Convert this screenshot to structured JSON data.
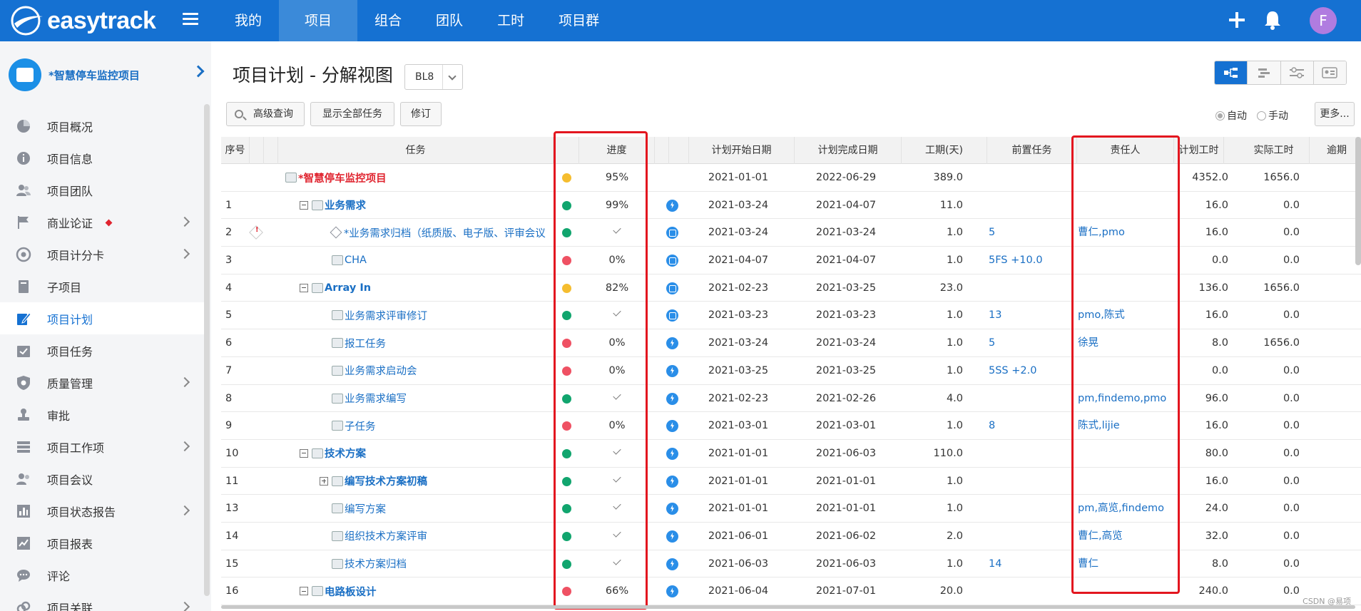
{
  "app": {
    "logo_text": "easytrack"
  },
  "topnav": {
    "items": [
      {
        "label": "我的",
        "active": false
      },
      {
        "label": "项目",
        "active": true
      },
      {
        "label": "组合",
        "active": false
      },
      {
        "label": "团队",
        "active": false
      },
      {
        "label": "工时",
        "active": false
      },
      {
        "label": "项目群",
        "active": false
      }
    ],
    "avatar_letter": "F",
    "accent_color": "#1571d2"
  },
  "sidebar": {
    "project_name": "*智慧停车监控项目",
    "items": [
      {
        "label": "项目概况",
        "icon": "pie-chart-icon",
        "has_arrow": false
      },
      {
        "label": "项目信息",
        "icon": "info-icon",
        "has_arrow": false
      },
      {
        "label": "项目团队",
        "icon": "team-icon",
        "has_arrow": false
      },
      {
        "label": "商业论证",
        "icon": "flag-icon",
        "has_arrow": true,
        "badge": true
      },
      {
        "label": "项目计分卡",
        "icon": "target-icon",
        "has_arrow": true
      },
      {
        "label": "子项目",
        "icon": "book-icon",
        "has_arrow": false
      },
      {
        "label": "项目计划",
        "icon": "edit-plan-icon",
        "has_arrow": false,
        "active": true
      },
      {
        "label": "项目任务",
        "icon": "task-calendar-icon",
        "has_arrow": false
      },
      {
        "label": "质量管理",
        "icon": "shield-icon",
        "has_arrow": true
      },
      {
        "label": "审批",
        "icon": "stamp-icon",
        "has_arrow": false
      },
      {
        "label": "项目工作项",
        "icon": "list-icon",
        "has_arrow": true
      },
      {
        "label": "项目会议",
        "icon": "meeting-icon",
        "has_arrow": false
      },
      {
        "label": "项目状态报告",
        "icon": "bar-chart-icon",
        "has_arrow": true
      },
      {
        "label": "项目报表",
        "icon": "report-icon",
        "has_arrow": false
      },
      {
        "label": "评论",
        "icon": "comment-icon",
        "has_arrow": false
      },
      {
        "label": "项目关联",
        "icon": "link-icon",
        "has_arrow": true
      }
    ]
  },
  "main": {
    "title": "项目计划 - 分解视图",
    "baseline": "BL8",
    "buttons": {
      "advanced_search": "高级查询",
      "show_all": "显示全部任务",
      "revise": "修订",
      "more": "更多..."
    },
    "radio": {
      "auto": "自动",
      "manual": "手动"
    }
  },
  "grid": {
    "headers": {
      "seq": "序号",
      "task": "任务",
      "progress": "进度",
      "start": "计划开始日期",
      "end": "计划完成日期",
      "duration": "工期(天)",
      "pred": "前置任务",
      "owner": "责任人",
      "plan_hours": "计划工时",
      "actual_hours": "实际工时",
      "overdue": "逾期"
    },
    "status_colors": {
      "yellow": "#f5bd2f",
      "green": "#11a56e",
      "red": "#ef5163"
    },
    "rows": [
      {
        "seq": "",
        "name": "*智慧停车监控项目",
        "level": 0,
        "kind": "root",
        "status": "yellow",
        "progress": "95%",
        "type": "",
        "start": "2021-01-01",
        "end": "2022-06-29",
        "duration": "389.0",
        "pred": "",
        "owner": "",
        "plan": "4352.0",
        "actual": "1656.0"
      },
      {
        "seq": "1",
        "name": "业务需求",
        "level": 1,
        "kind": "summary",
        "expander": "minus",
        "status": "green",
        "progress": "99%",
        "type": "auto",
        "start": "2021-03-24",
        "end": "2021-04-07",
        "duration": "11.0",
        "pred": "",
        "owner": "",
        "plan": "16.0",
        "actual": "0.0"
      },
      {
        "seq": "2",
        "name": "*业务需求归档（纸质版、电子版、评审会议",
        "level": 2,
        "kind": "milestone",
        "warn": true,
        "status": "green",
        "progress": "",
        "done": true,
        "type": "manual",
        "start": "2021-03-24",
        "end": "2021-03-24",
        "duration": "1.0",
        "pred": "5",
        "owner": "曹仁,pmo",
        "plan": "16.0",
        "actual": "0.0"
      },
      {
        "seq": "3",
        "name": "CHA",
        "level": 2,
        "kind": "task",
        "status": "red",
        "progress": "0%",
        "type": "manual",
        "start": "2021-04-07",
        "end": "2021-04-07",
        "duration": "1.0",
        "pred": "5FS +10.0",
        "owner": "",
        "plan": "0.0",
        "actual": "0.0"
      },
      {
        "seq": "4",
        "name": "Array In",
        "level": 1,
        "kind": "summary",
        "expander": "minus",
        "status": "yellow",
        "progress": "82%",
        "type": "manual",
        "start": "2021-02-23",
        "end": "2021-03-25",
        "duration": "23.0",
        "pred": "",
        "owner": "",
        "plan": "136.0",
        "actual": "1656.0"
      },
      {
        "seq": "5",
        "name": "业务需求评审修订",
        "level": 2,
        "kind": "task",
        "status": "green",
        "progress": "",
        "done": true,
        "type": "manual",
        "start": "2021-03-23",
        "end": "2021-03-23",
        "duration": "1.0",
        "pred": "13",
        "owner": "pmo,陈式",
        "plan": "16.0",
        "actual": "0.0"
      },
      {
        "seq": "6",
        "name": "报工任务",
        "level": 2,
        "kind": "task",
        "status": "red",
        "progress": "0%",
        "type": "auto",
        "start": "2021-03-24",
        "end": "2021-03-24",
        "duration": "1.0",
        "pred": "5",
        "owner": "徐晃",
        "plan": "8.0",
        "actual": "1656.0"
      },
      {
        "seq": "7",
        "name": "业务需求启动会",
        "level": 2,
        "kind": "task",
        "status": "red",
        "progress": "0%",
        "type": "auto",
        "start": "2021-03-25",
        "end": "2021-03-25",
        "duration": "1.0",
        "pred": "5SS +2.0",
        "owner": "",
        "plan": "0.0",
        "actual": "0.0"
      },
      {
        "seq": "8",
        "name": "业务需求编写",
        "level": 2,
        "kind": "task",
        "status": "green",
        "progress": "",
        "done": true,
        "type": "auto",
        "start": "2021-02-23",
        "end": "2021-02-26",
        "duration": "4.0",
        "pred": "",
        "owner": "pm,findemo,pmo",
        "plan": "96.0",
        "actual": "0.0"
      },
      {
        "seq": "9",
        "name": "子任务",
        "level": 2,
        "kind": "task",
        "status": "red",
        "progress": "0%",
        "type": "auto",
        "start": "2021-03-01",
        "end": "2021-03-01",
        "duration": "1.0",
        "pred": "8",
        "owner": "陈式,lijie",
        "plan": "16.0",
        "actual": "0.0"
      },
      {
        "seq": "10",
        "name": "技术方案",
        "level": 1,
        "kind": "summary",
        "expander": "minus",
        "status": "green",
        "progress": "",
        "done": true,
        "type": "auto",
        "start": "2021-01-01",
        "end": "2021-06-03",
        "duration": "110.0",
        "pred": "",
        "owner": "",
        "plan": "80.0",
        "actual": "0.0"
      },
      {
        "seq": "11",
        "name": "编写技术方案初稿",
        "level": 2,
        "kind": "summary",
        "expander": "plus",
        "status": "green",
        "progress": "",
        "done": true,
        "type": "auto",
        "start": "2021-01-01",
        "end": "2021-01-01",
        "duration": "1.0",
        "pred": "",
        "owner": "",
        "plan": "16.0",
        "actual": "0.0"
      },
      {
        "seq": "13",
        "name": "编写方案",
        "level": 2,
        "kind": "task",
        "status": "green",
        "progress": "",
        "done": true,
        "type": "auto",
        "start": "2021-01-01",
        "end": "2021-01-01",
        "duration": "1.0",
        "pred": "",
        "owner": "pm,高览,findemo",
        "plan": "24.0",
        "actual": "0.0"
      },
      {
        "seq": "14",
        "name": "组织技术方案评审",
        "level": 2,
        "kind": "task",
        "status": "green",
        "progress": "",
        "done": true,
        "type": "auto",
        "start": "2021-06-01",
        "end": "2021-06-02",
        "duration": "2.0",
        "pred": "",
        "owner": "曹仁,高览",
        "plan": "32.0",
        "actual": "0.0"
      },
      {
        "seq": "15",
        "name": "技术方案归档",
        "level": 2,
        "kind": "task",
        "status": "green",
        "progress": "",
        "done": true,
        "type": "auto",
        "start": "2021-06-03",
        "end": "2021-06-03",
        "duration": "1.0",
        "pred": "14",
        "owner": "曹仁",
        "plan": "8.0",
        "actual": "0.0"
      },
      {
        "seq": "16",
        "name": "电路板设计",
        "level": 1,
        "kind": "summary",
        "expander": "minus",
        "status": "red",
        "progress": "66%",
        "type": "auto",
        "start": "2021-06-04",
        "end": "2021-07-01",
        "duration": "20.0",
        "pred": "",
        "owner": "",
        "plan": "240.0",
        "actual": "0.0"
      }
    ]
  },
  "watermark": "CSDN @易项"
}
